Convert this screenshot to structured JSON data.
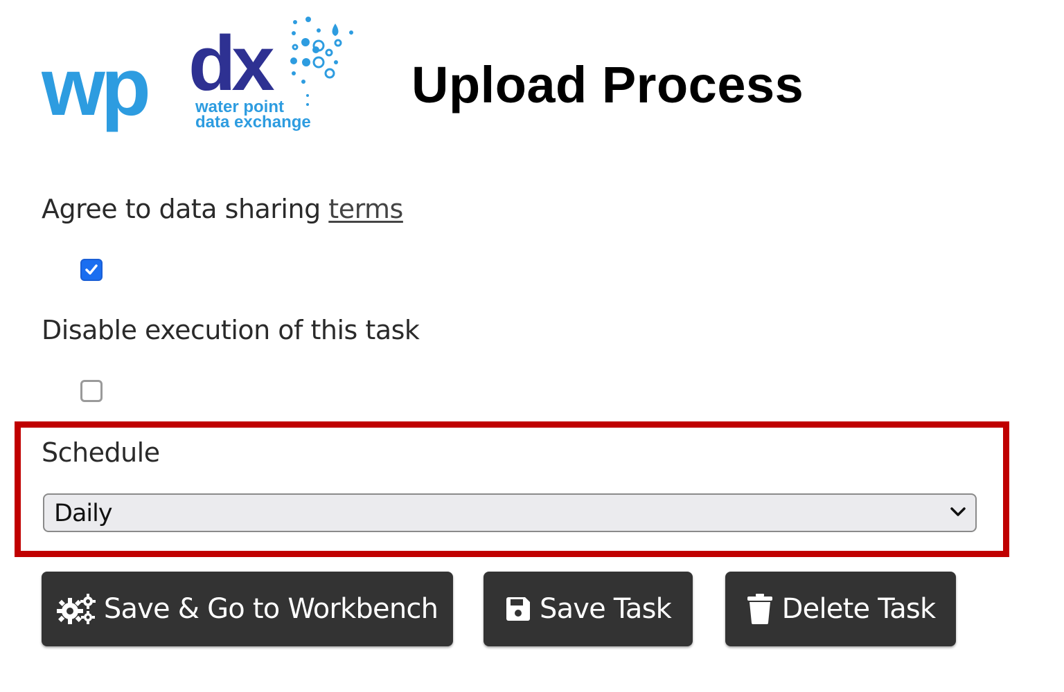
{
  "brand": {
    "logo_text": "wpdx",
    "tagline_line1": "water point",
    "tagline_line2": "data exchange",
    "colors": {
      "light_blue": "#2d9ce0",
      "dark_blue": "#2e3192"
    }
  },
  "header": {
    "title": "Upload Process"
  },
  "form": {
    "terms": {
      "label": "Agree to data sharing",
      "link_text": "terms",
      "checked": true
    },
    "disable": {
      "label": "Disable execution of this task",
      "checked": false
    },
    "schedule": {
      "label": "Schedule",
      "value": "Daily"
    }
  },
  "actions": {
    "workbench_label": "Save & Go to Workbench",
    "save_label": "Save Task",
    "delete_label": "Delete Task"
  },
  "colors": {
    "highlight": "#c00000",
    "button_bg": "#333333",
    "checkbox": "#1a6ef0"
  },
  "icons": [
    "gears-icon",
    "floppy-disk-icon",
    "trash-icon",
    "check-icon",
    "chevron-down-icon"
  ]
}
